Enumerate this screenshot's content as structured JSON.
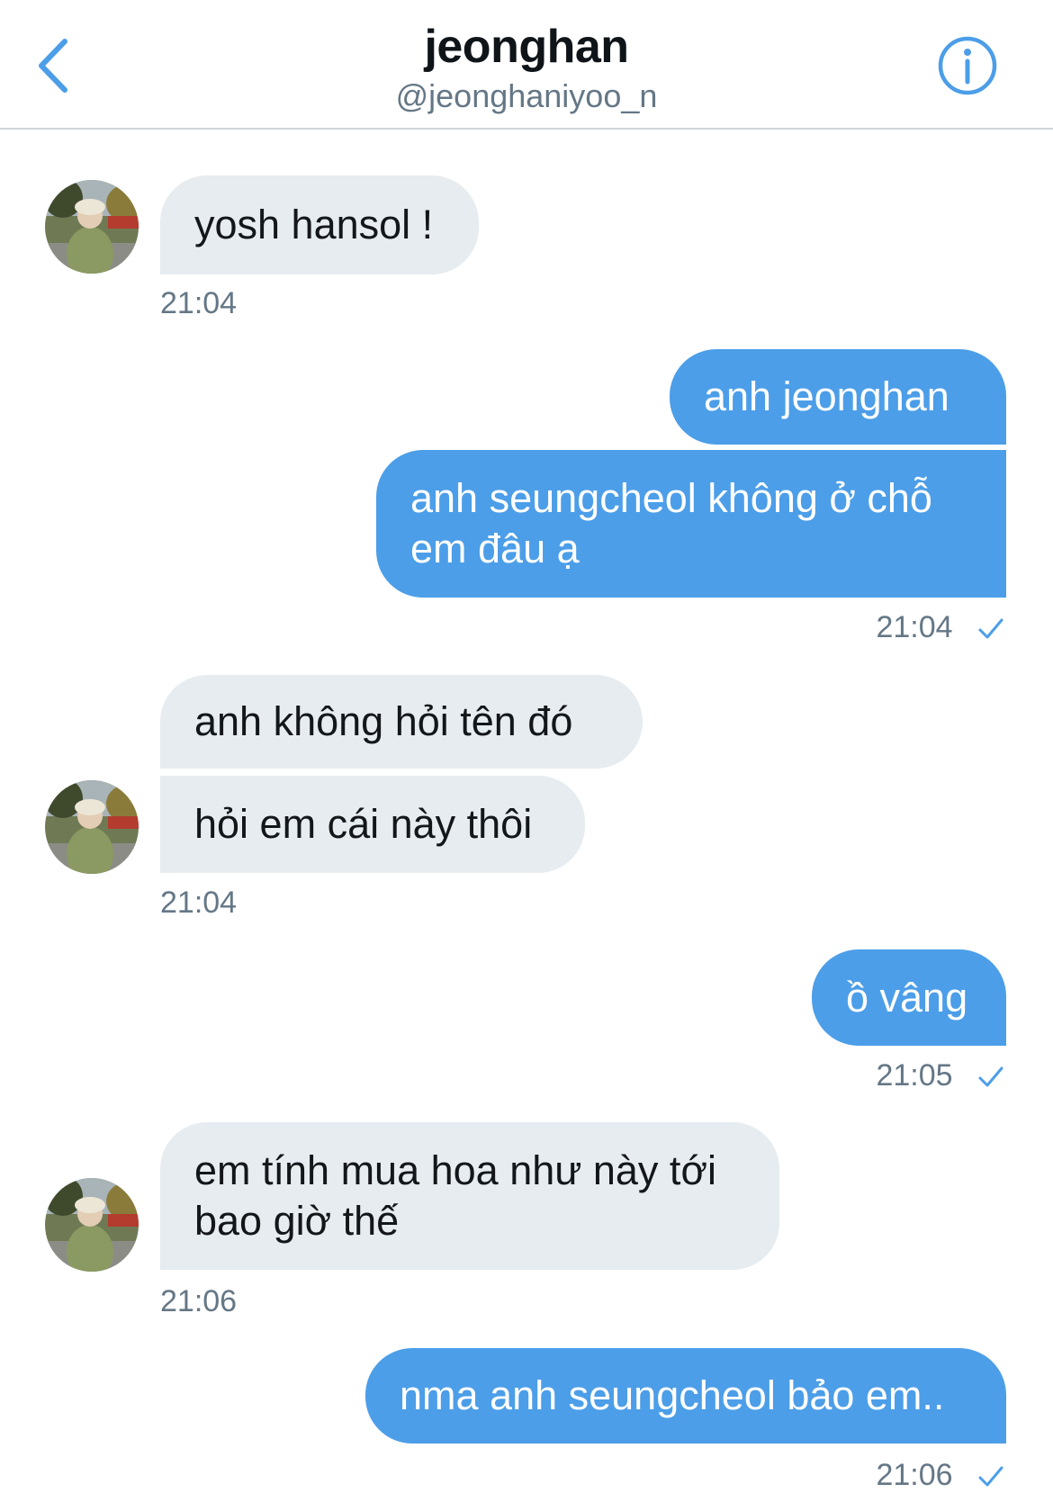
{
  "header": {
    "name": "jeonghan",
    "handle": "@jeonghaniyoo_n"
  },
  "icons": {
    "back": "chevron-left-icon",
    "info": "info-icon",
    "read": "checkmark-icon"
  },
  "colors": {
    "accent": "#4c9ee8",
    "incoming_bubble": "#e6ecf0",
    "secondary_text": "#657786"
  },
  "messages": [
    {
      "from": "them",
      "text": "yosh hansol !"
    },
    {
      "from": "me",
      "text": "anh jeonghan"
    },
    {
      "from": "me",
      "text": "anh seungcheol không ở chỗ em đâu ạ"
    },
    {
      "from": "them",
      "text": "anh không hỏi tên đó"
    },
    {
      "from": "them",
      "text": "hỏi em cái này thôi"
    },
    {
      "from": "me",
      "text": "ồ vâng"
    },
    {
      "from": "them",
      "text": "em tính mua hoa như này tới bao giờ thế"
    },
    {
      "from": "me",
      "text": "nma anh seungcheol bảo em.."
    }
  ],
  "timestamps": [
    "21:04",
    "21:04",
    "21:04",
    "21:05",
    "21:06",
    "21:06"
  ]
}
